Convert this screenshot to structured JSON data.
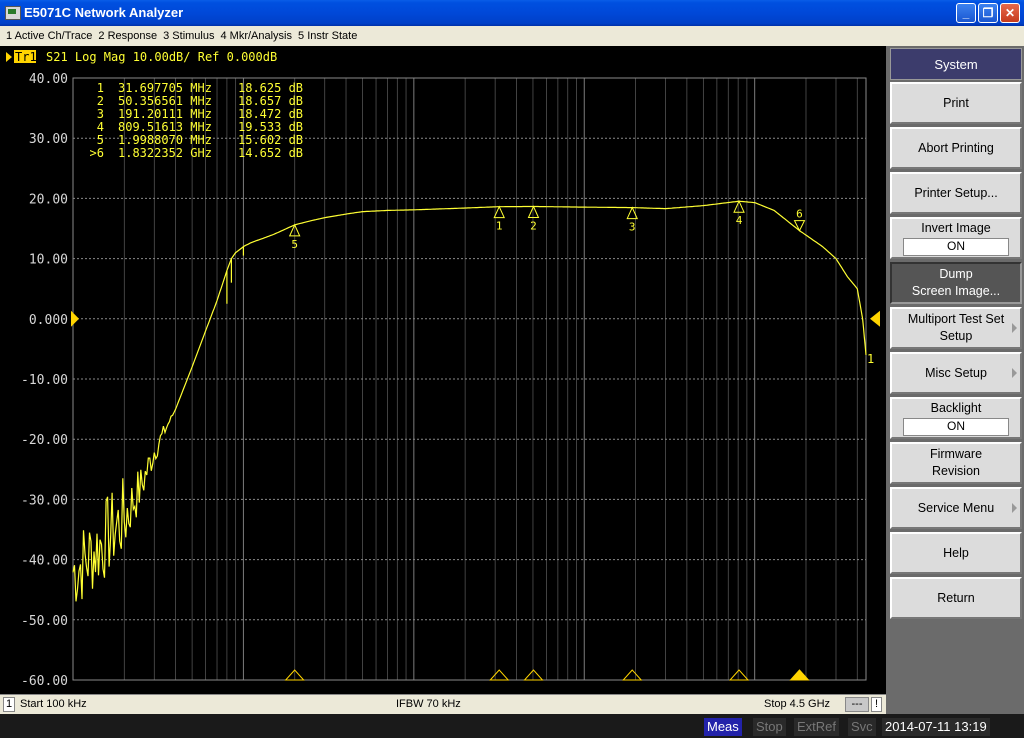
{
  "window": {
    "title": "E5071C Network Analyzer"
  },
  "menu": [
    "1 Active Ch/Trace",
    "2 Response",
    "3 Stimulus",
    "4 Mkr/Analysis",
    "5 Instr State"
  ],
  "trace_header": {
    "tag": "Tr1",
    "text": "S21 Log Mag 10.00dB/ Ref 0.000dB"
  },
  "markers_table": [
    {
      "id": "1",
      "freq": "31.697705 MHz",
      "val": "18.625 dB"
    },
    {
      "id": "2",
      "freq": "50.356561 MHz",
      "val": "18.657 dB"
    },
    {
      "id": "3",
      "freq": "191.20111 MHz",
      "val": "18.472 dB"
    },
    {
      "id": "4",
      "freq": "809.51613 MHz",
      "val": "19.533 dB"
    },
    {
      "id": "5",
      "freq": "1.9988070 MHz",
      "val": "15.602 dB"
    },
    {
      "id": ">6",
      "freq": "1.8322352 GHz",
      "val": "14.652 dB"
    }
  ],
  "y_axis_labels": [
    "40.00",
    "30.00",
    "20.00",
    "10.00",
    "0.000",
    "-10.00",
    "-20.00",
    "-30.00",
    "-40.00",
    "-50.00",
    "-60.00"
  ],
  "trace_end_label": "1",
  "chart_status": {
    "channel": "1",
    "start": "Start 100 kHz",
    "ifbw": "IFBW 70 kHz",
    "stop": "Stop 4.5 GHz",
    "dashes": "---",
    "bang": "!"
  },
  "softkeys": {
    "title": "System",
    "items": [
      {
        "label": "Print"
      },
      {
        "label": "Abort Printing"
      },
      {
        "label": "Printer Setup..."
      },
      {
        "label": "Invert Image",
        "state": "ON"
      },
      {
        "label": "Dump",
        "label2": "Screen Image...",
        "pressed": true
      },
      {
        "label": "Multiport Test Set",
        "label2": "Setup",
        "submenu": true
      },
      {
        "label": "Misc Setup",
        "submenu": true
      },
      {
        "label": "Backlight",
        "state": "ON"
      },
      {
        "label": "Firmware",
        "label2": "Revision"
      },
      {
        "label": "Service Menu",
        "submenu": true
      },
      {
        "label": "Help"
      },
      {
        "label": "Return"
      }
    ]
  },
  "status": {
    "meas": "Meas",
    "stop": "Stop",
    "extref": "ExtRef",
    "svc": "Svc",
    "datetime": "2014-07-11 13:19"
  },
  "colors": {
    "trace": "#ffff33",
    "grid": "#8a8a8a",
    "text": "#d8d8d8",
    "meas_bg": "#2222aa"
  },
  "chart_data": {
    "type": "line",
    "title": "S21 Log Mag 10.00dB/ Ref 0.000dB",
    "x_scale": "log",
    "xlim_hz": [
      100000,
      4500000000
    ],
    "ylim": [
      -60,
      40
    ],
    "ylabel_unit": "dB",
    "series": [
      {
        "name": "S21",
        "x_hz": [
          100000,
          120000,
          150000,
          200000,
          250000,
          300000,
          400000,
          500000,
          600000,
          700000,
          800000,
          850000,
          900000,
          950000,
          1000000,
          1100000,
          1200000,
          1500000,
          1998807,
          2500000,
          3000000,
          4000000,
          5000000,
          7000000,
          10000000,
          20000000,
          31697705,
          50356561,
          100000000,
          191201110,
          300000000,
          500000000,
          809516130,
          1000000000,
          1300000000,
          1832235200,
          2500000000,
          3000000000,
          3500000000,
          4000000000,
          4300000000,
          4400000000,
          4500000000
        ],
        "y_db": [
          -42,
          -40,
          -37,
          -33,
          -28,
          -22,
          -15,
          -8,
          -2,
          3,
          8,
          10,
          11,
          11.5,
          12,
          12.6,
          13,
          14,
          15.602,
          16.3,
          16.8,
          17.4,
          17.8,
          18,
          18.1,
          18.4,
          18.625,
          18.657,
          18.55,
          18.472,
          18.3,
          18.8,
          19.533,
          19.3,
          18,
          14.652,
          12,
          10,
          7,
          5,
          0,
          -3,
          -6
        ],
        "notches": [
          {
            "x_hz": 800000,
            "y_db": 2.5
          },
          {
            "x_hz": 850000,
            "y_db": 6
          },
          {
            "x_hz": 1000000,
            "y_db": 10.5
          }
        ]
      }
    ],
    "markers": [
      {
        "id": "1",
        "x_hz": 31697705,
        "y_db": 18.625
      },
      {
        "id": "2",
        "x_hz": 50356561,
        "y_db": 18.657
      },
      {
        "id": "3",
        "x_hz": 191201110,
        "y_db": 18.472
      },
      {
        "id": "4",
        "x_hz": 809516130,
        "y_db": 19.533
      },
      {
        "id": "5",
        "x_hz": 1998807,
        "y_db": 15.602
      },
      {
        "id": "6",
        "x_hz": 1832235200,
        "y_db": 14.652,
        "active": true
      }
    ],
    "reference_level_db": 0
  }
}
